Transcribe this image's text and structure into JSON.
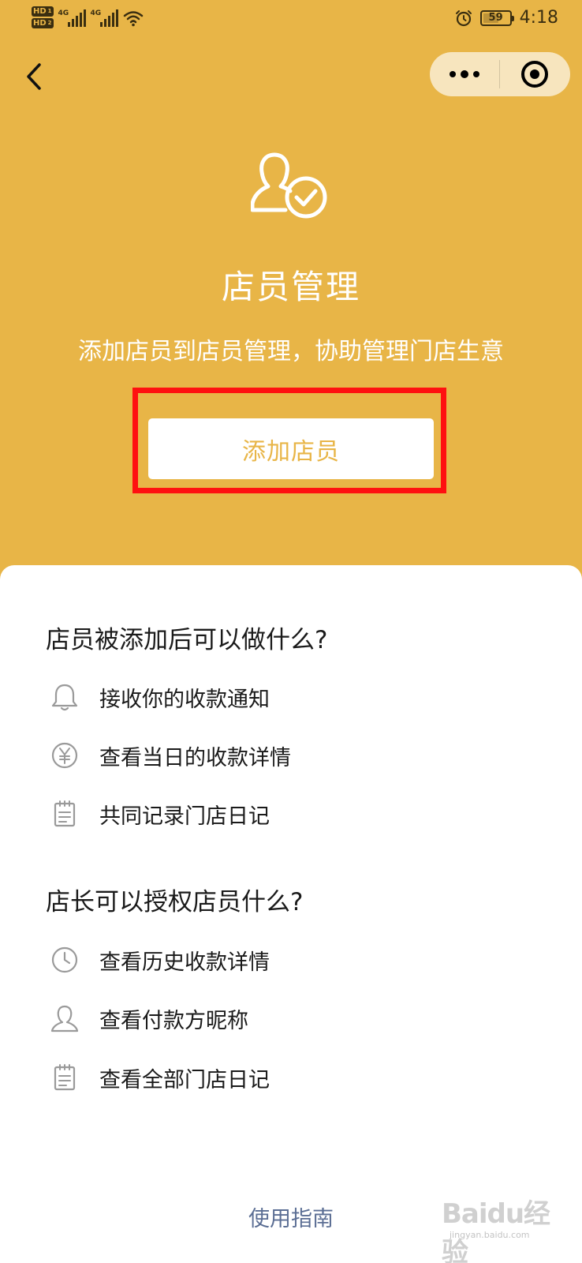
{
  "status_bar": {
    "hd1": "HD",
    "hd1_sub": "1",
    "hd2": "HD",
    "hd2_sub": "2",
    "sim1_label": "4G",
    "sim2_label": "4G",
    "battery_level": "59",
    "time": "4:18"
  },
  "nav": {
    "back_icon": "chevron-left-icon",
    "more_icon": "more-dots-icon",
    "close_icon": "target-ring-icon"
  },
  "hero": {
    "icon": "user-check-icon",
    "title": "店员管理",
    "subtitle": "添加店员到店员管理，协助管理门店生意",
    "add_button_label": "添加店员"
  },
  "sections": [
    {
      "title": "店员被添加后可以做什么?",
      "items": [
        {
          "icon": "bell-icon",
          "label": "接收你的收款通知"
        },
        {
          "icon": "yuan-coin-icon",
          "label": "查看当日的收款详情"
        },
        {
          "icon": "notepad-icon",
          "label": "共同记录门店日记"
        }
      ]
    },
    {
      "title": "店长可以授权店员什么?",
      "items": [
        {
          "icon": "clock-icon",
          "label": "查看历史收款详情"
        },
        {
          "icon": "user-icon",
          "label": "查看付款方昵称"
        },
        {
          "icon": "notepad-icon",
          "label": "查看全部门店日记"
        }
      ]
    }
  ],
  "footer": {
    "guide_label": "使用指南"
  },
  "watermark": {
    "text": "Baidu经验",
    "sub": "jingyan.baidu.com"
  },
  "colors": {
    "header_bg": "#E8B547",
    "highlight": "#FF1010",
    "link": "#5B6E94"
  }
}
